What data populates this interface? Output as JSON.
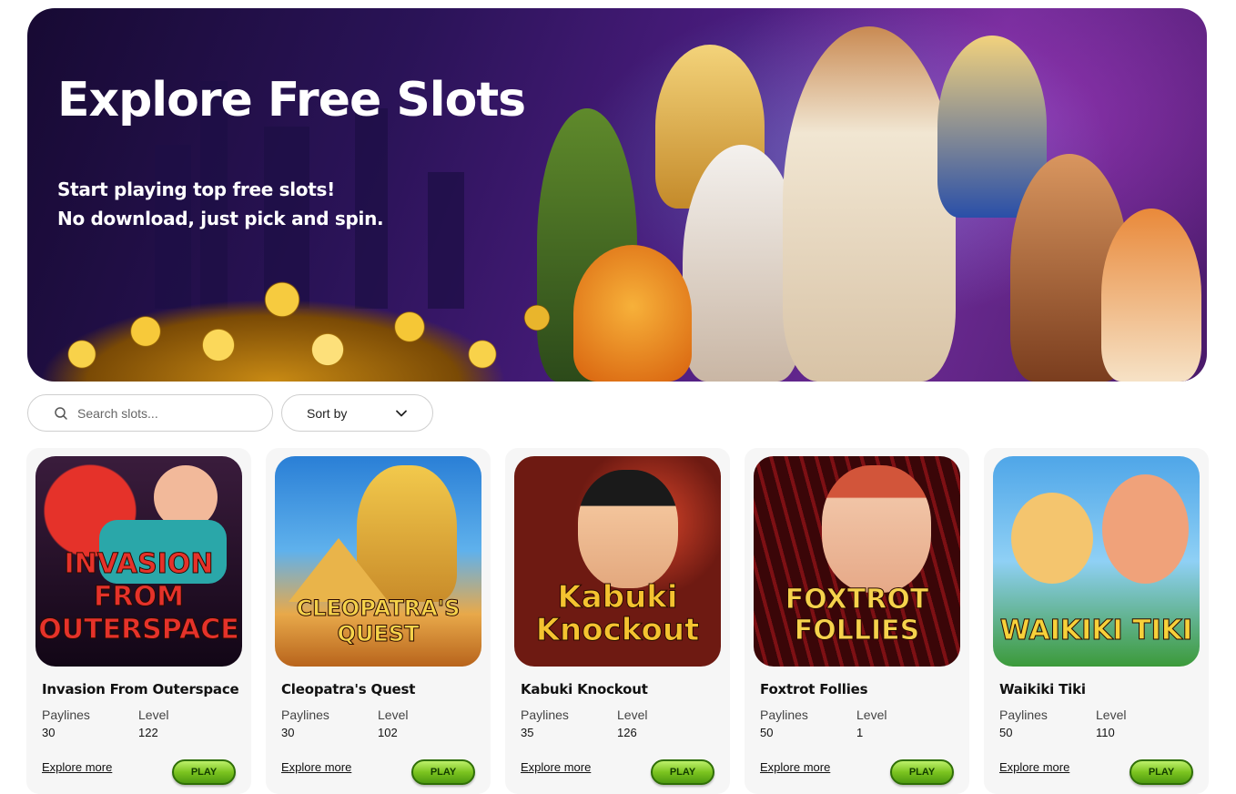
{
  "hero": {
    "title": "Explore Free Slots",
    "subtitle_line1": "Start playing top free slots!",
    "subtitle_line2": "No download, just pick and spin."
  },
  "search": {
    "placeholder": "Search slots..."
  },
  "sort": {
    "label": "Sort by"
  },
  "labels": {
    "paylines": "Paylines",
    "level": "Level",
    "explore": "Explore more",
    "play": "PLAY"
  },
  "games": [
    {
      "title": "Invasion From Outerspace",
      "logo": "INVASION FROM OUTERSPACE",
      "paylines": "30",
      "level": "122"
    },
    {
      "title": "Cleopatra's Quest",
      "logo": "CLEOPATRA'S QUEST",
      "paylines": "30",
      "level": "102"
    },
    {
      "title": "Kabuki Knockout",
      "logo": "Kabuki Knockout",
      "paylines": "35",
      "level": "126"
    },
    {
      "title": "Foxtrot Follies",
      "logo": "FOXTROT FOLLIES",
      "paylines": "50",
      "level": "1"
    },
    {
      "title": "Waikiki Tiki",
      "logo": "WAIKIKI TIKI",
      "paylines": "50",
      "level": "110"
    }
  ],
  "colors": {
    "play_button": "#7cc420",
    "hero_bg": "#4a1c7e",
    "card_bg": "#f6f6f6"
  }
}
